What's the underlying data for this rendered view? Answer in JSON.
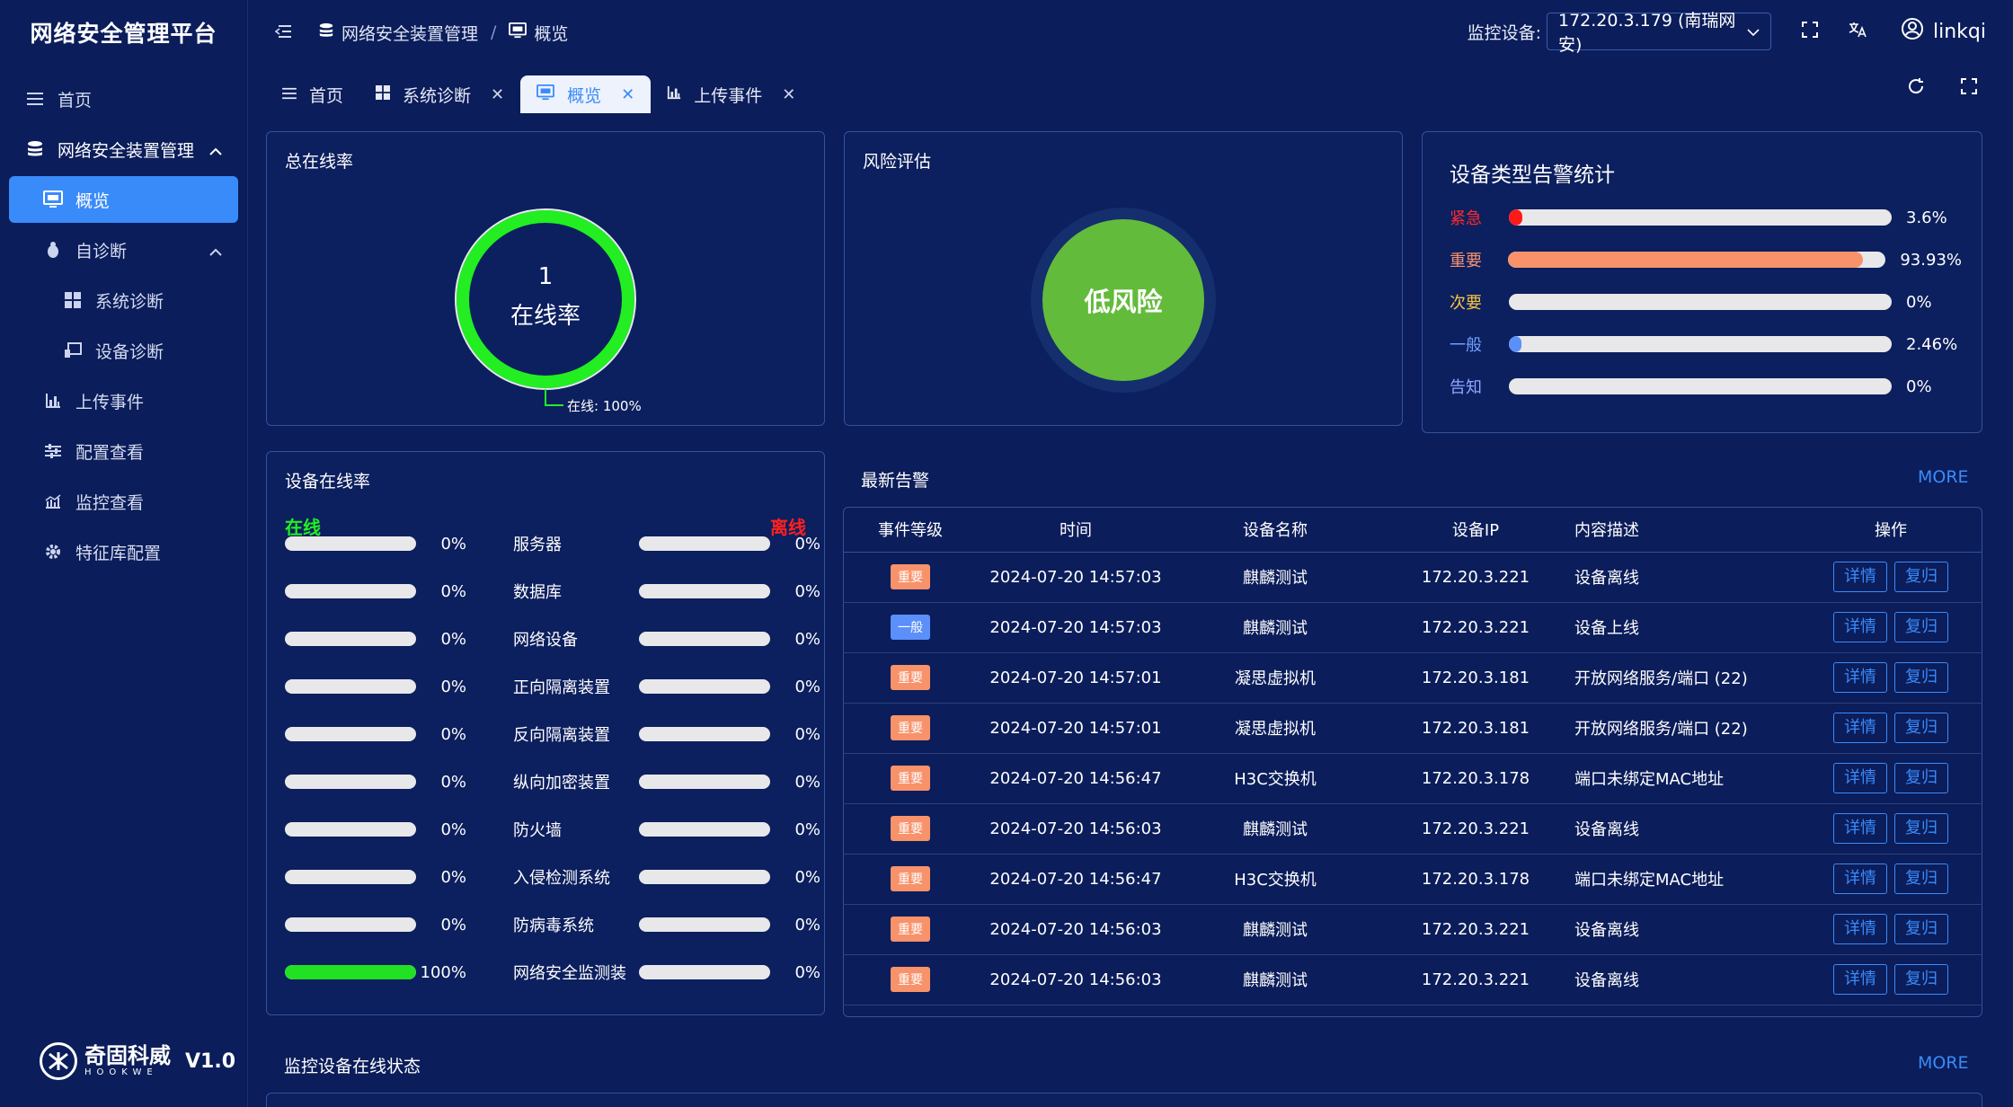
{
  "app": {
    "title": "网络安全管理平台"
  },
  "sidebar": {
    "items": [
      {
        "label": "首页"
      },
      {
        "label": "网络安全装置管理"
      },
      {
        "label": "概览"
      },
      {
        "label": "自诊断"
      },
      {
        "label": "系统诊断"
      },
      {
        "label": "设备诊断"
      },
      {
        "label": "上传事件"
      },
      {
        "label": "配置查看"
      },
      {
        "label": "监控查看"
      },
      {
        "label": "特征库配置"
      }
    ],
    "brand_cn": "奇固科威",
    "brand_en": "HOOKWE",
    "version": "V1.0"
  },
  "header": {
    "breadcrumb": [
      "网络安全装置管理",
      "概览"
    ],
    "device_label": "监控设备:",
    "device_value": "172.20.3.179 (南瑞网安)",
    "user": "linkqi"
  },
  "tabs": [
    {
      "label": "首页"
    },
    {
      "label": "系统诊断"
    },
    {
      "label": "概览"
    },
    {
      "label": "上传事件"
    }
  ],
  "online_rate": {
    "title": "总在线率",
    "value": "1",
    "label": "在线率",
    "legend": "在线: 100%",
    "percent": 100
  },
  "risk": {
    "title": "风险评估",
    "value": "低风险"
  },
  "alarm_stats": {
    "title": "设备类型告警统计",
    "rows": [
      {
        "label": "紧急",
        "pct": "3.6%",
        "value": 3.6,
        "color": "#ff1a1a",
        "label_color": "#ff2a2a"
      },
      {
        "label": "重要",
        "pct": "93.93%",
        "value": 93.93,
        "color": "#f7926b",
        "label_color": "#f7926b"
      },
      {
        "label": "次要",
        "pct": "0%",
        "value": 0,
        "color": "#f5c542",
        "label_color": "#f5c542"
      },
      {
        "label": "一般",
        "pct": "2.46%",
        "value": 2.46,
        "color": "#5b8ff9",
        "label_color": "#6ea1ff"
      },
      {
        "label": "告知",
        "pct": "0%",
        "value": 0,
        "color": "#8fa8ff",
        "label_color": "#8fa8ff"
      }
    ]
  },
  "device_online": {
    "title": "设备在线率",
    "online_label": "在线",
    "offline_label": "离线",
    "rows": [
      {
        "name": "服务器",
        "online": "0%",
        "offline": "0%",
        "online_value": 0,
        "offline_value": 0
      },
      {
        "name": "数据库",
        "online": "0%",
        "offline": "0%",
        "online_value": 0,
        "offline_value": 0
      },
      {
        "name": "网络设备",
        "online": "0%",
        "offline": "0%",
        "online_value": 0,
        "offline_value": 0
      },
      {
        "name": "正向隔离装置",
        "online": "0%",
        "offline": "0%",
        "online_value": 0,
        "offline_value": 0
      },
      {
        "name": "反向隔离装置",
        "online": "0%",
        "offline": "0%",
        "online_value": 0,
        "offline_value": 0
      },
      {
        "name": "纵向加密装置",
        "online": "0%",
        "offline": "0%",
        "online_value": 0,
        "offline_value": 0
      },
      {
        "name": "防火墙",
        "online": "0%",
        "offline": "0%",
        "online_value": 0,
        "offline_value": 0
      },
      {
        "name": "入侵检测系统",
        "online": "0%",
        "offline": "0%",
        "online_value": 0,
        "offline_value": 0
      },
      {
        "name": "防病毒系统",
        "online": "0%",
        "offline": "0%",
        "online_value": 0,
        "offline_value": 0
      },
      {
        "name": "网络安全监测装",
        "online": "100%",
        "offline": "0%",
        "online_value": 100,
        "offline_value": 0
      }
    ]
  },
  "latest_alarms": {
    "title": "最新告警",
    "more": "MORE",
    "columns": [
      "事件等级",
      "时间",
      "设备名称",
      "设备IP",
      "内容描述",
      "操作"
    ],
    "detail_label": "详情",
    "restore_label": "复归",
    "rows": [
      {
        "level": "重要",
        "level_color": "#f7926b",
        "time": "2024-07-20 14:57:03",
        "device": "麒麟测试",
        "ip": "172.20.3.221",
        "desc": "设备离线"
      },
      {
        "level": "一般",
        "level_color": "#5b8ff9",
        "time": "2024-07-20 14:57:03",
        "device": "麒麟测试",
        "ip": "172.20.3.221",
        "desc": "设备上线"
      },
      {
        "level": "重要",
        "level_color": "#f7926b",
        "time": "2024-07-20 14:57:01",
        "device": "凝思虚拟机",
        "ip": "172.20.3.181",
        "desc": "开放网络服务/端口 (22)"
      },
      {
        "level": "重要",
        "level_color": "#f7926b",
        "time": "2024-07-20 14:57:01",
        "device": "凝思虚拟机",
        "ip": "172.20.3.181",
        "desc": "开放网络服务/端口 (22)"
      },
      {
        "level": "重要",
        "level_color": "#f7926b",
        "time": "2024-07-20 14:56:47",
        "device": "H3C交换机",
        "ip": "172.20.3.178",
        "desc": "端口未绑定MAC地址"
      },
      {
        "level": "重要",
        "level_color": "#f7926b",
        "time": "2024-07-20 14:56:03",
        "device": "麒麟测试",
        "ip": "172.20.3.221",
        "desc": "设备离线"
      },
      {
        "level": "重要",
        "level_color": "#f7926b",
        "time": "2024-07-20 14:56:47",
        "device": "H3C交换机",
        "ip": "172.20.3.178",
        "desc": "端口未绑定MAC地址"
      },
      {
        "level": "重要",
        "level_color": "#f7926b",
        "time": "2024-07-20 14:56:03",
        "device": "麒麟测试",
        "ip": "172.20.3.221",
        "desc": "设备离线"
      },
      {
        "level": "重要",
        "level_color": "#f7926b",
        "time": "2024-07-20 14:56:03",
        "device": "麒麟测试",
        "ip": "172.20.3.221",
        "desc": "设备离线"
      }
    ]
  },
  "monitor_status": {
    "title": "监控设备在线状态",
    "more": "MORE"
  }
}
